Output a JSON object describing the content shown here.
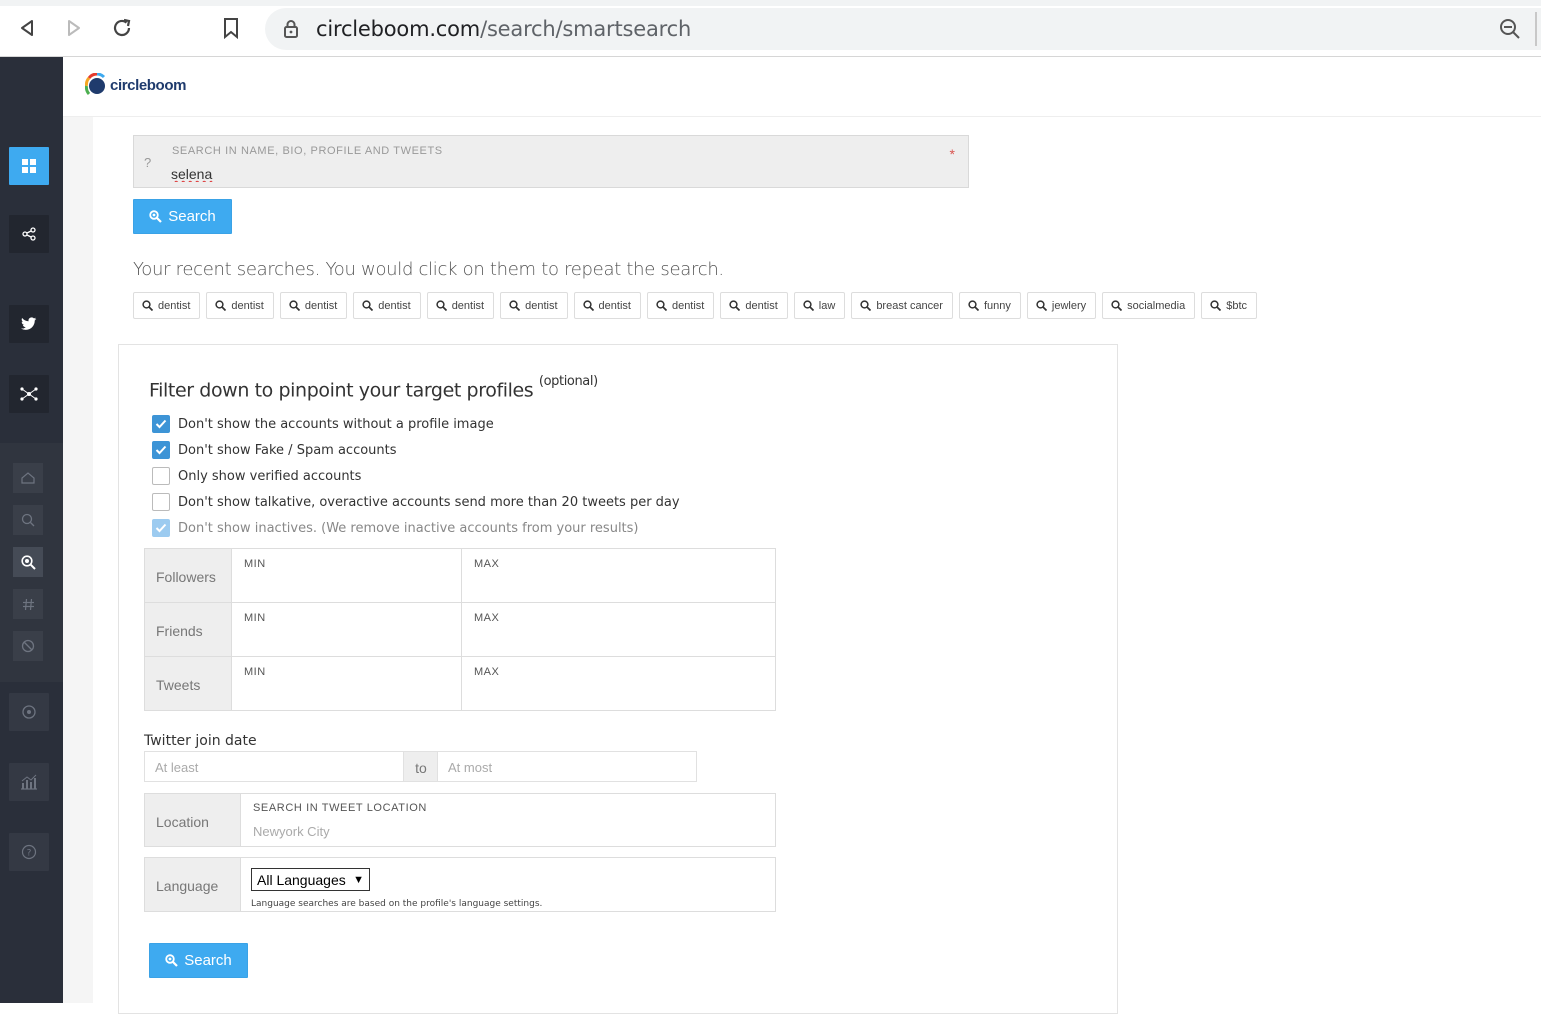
{
  "browser": {
    "url_domain": "circleboom.com",
    "url_path": "/search/smartsearch"
  },
  "app": {
    "logo_text": "circleboom"
  },
  "search": {
    "label": "SEARCH IN NAME, BIO, PROFILE AND TWEETS",
    "help_glyph": "?",
    "required_mark": "*",
    "value": "selena",
    "button_label": "Search"
  },
  "recent": {
    "title": "Your recent searches. You would click on them to repeat the search.",
    "items": [
      "dentist",
      "dentist",
      "dentist",
      "dentist",
      "dentist",
      "dentist",
      "dentist",
      "dentist",
      "dentist",
      "law",
      "breast cancer",
      "funny",
      "jewlery",
      "socialmedia",
      "$btc"
    ]
  },
  "filters": {
    "title": "Filter down to pinpoint your target profiles",
    "title_suffix": "(optional)",
    "checkboxes": [
      {
        "label": "Don't show the accounts without a profile image",
        "checked": true
      },
      {
        "label": "Don't show Fake / Spam accounts",
        "checked": true
      },
      {
        "label": "Only show verified accounts",
        "checked": false
      },
      {
        "label": "Don't show talkative, overactive accounts send more than 20 tweets per day",
        "checked": false
      },
      {
        "label": "Don't show inactives. (We remove inactive accounts from your results)",
        "checked": true
      }
    ],
    "ranges": [
      {
        "label": "Followers",
        "min": "MIN",
        "max": "MAX"
      },
      {
        "label": "Friends",
        "min": "MIN",
        "max": "MAX"
      },
      {
        "label": "Tweets",
        "min": "MIN",
        "max": "MAX"
      }
    ],
    "join_date": {
      "label": "Twitter join date",
      "from_placeholder": "At least",
      "to_label": "to",
      "to_placeholder": "At most"
    },
    "location": {
      "label": "Location",
      "field_label": "SEARCH IN TWEET LOCATION",
      "placeholder": "Newyork City"
    },
    "language": {
      "label": "Language",
      "selected": "All Languages",
      "arrow": "▼",
      "note": "Language searches are based on the profile's language settings."
    },
    "button_label": "Search"
  },
  "colors": {
    "accent": "#3eaaf0",
    "sidebar": "#2a2f3a",
    "checkbox_on": "#3d94d6"
  }
}
